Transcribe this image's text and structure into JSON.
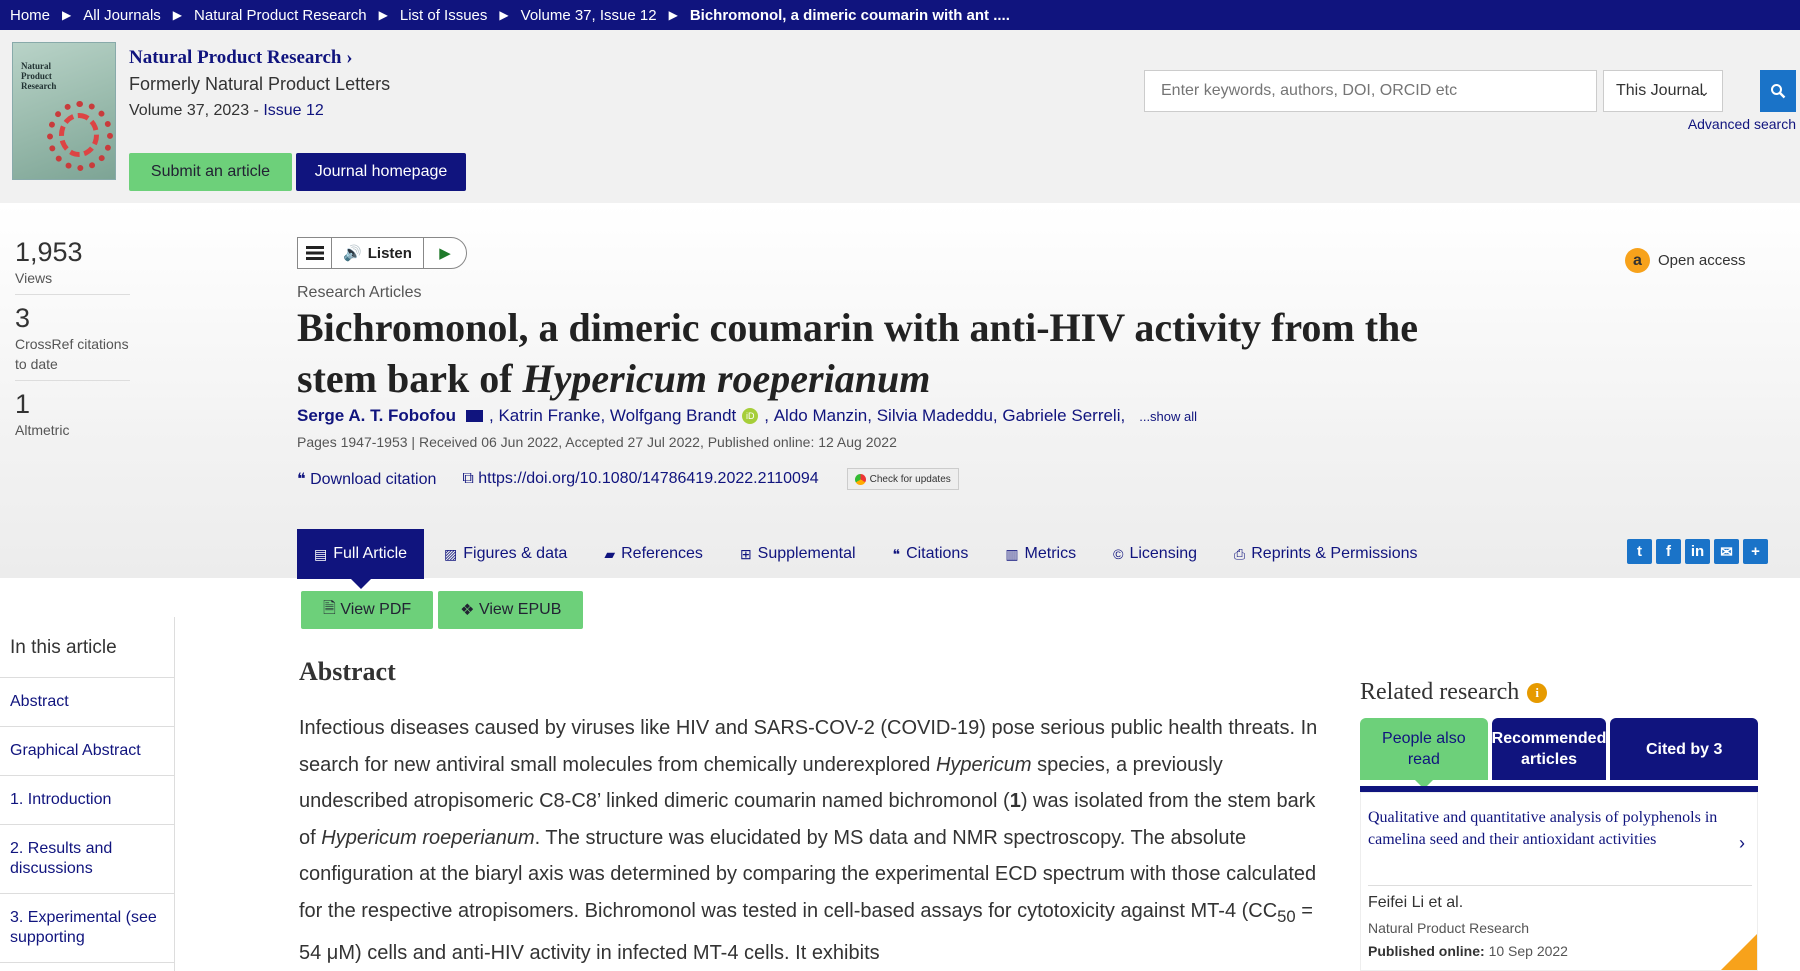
{
  "breadcrumb": {
    "items": [
      "Home",
      "All Journals",
      "Natural Product Research",
      "List of Issues",
      "Volume 37, Issue 12",
      "Bichromonol, a dimeric coumarin with ant ...."
    ]
  },
  "journal": {
    "title": "Natural Product Research",
    "former": "Formerly Natural Product Letters",
    "volume_prefix": "Volume 37, 2023 - ",
    "issue_link": "Issue 12",
    "submit_label": "Submit an article",
    "homepage_label": "Journal homepage",
    "cover_text": "Natural Product Research"
  },
  "search": {
    "placeholder": "Enter keywords, authors, DOI, ORCID etc",
    "scope_value": "This Journal",
    "advanced_label": "Advanced search"
  },
  "metrics": [
    {
      "value": "1,953",
      "label": "Views"
    },
    {
      "value": "3",
      "label": "CrossRef citations to date"
    },
    {
      "value": "1",
      "label": "Altmetric"
    }
  ],
  "toolbar": {
    "listen_label": "Listen"
  },
  "open_access_label": "Open access",
  "article": {
    "type": "Research Articles",
    "title_plain": "Bichromonol, a dimeric coumarin with anti-HIV activity from the stem bark of ",
    "title_italic": "Hypericum roeperianum",
    "first_author": "Serge A. T. Fobofou",
    "authors_a": "Katrin Franke, Wolfgang Brandt",
    "authors_b": "Aldo Manzin, Silvia Madeddu, Gabriele Serreli,",
    "show_all": "...show all",
    "pages_line": "Pages 1947-1953 | Received 06 Jun 2022, Accepted 27 Jul 2022, Published online: 12 Aug 2022",
    "download_citation": "Download citation",
    "doi": "https://doi.org/10.1080/14786419.2022.2110094",
    "check_updates": "Check for updates"
  },
  "tabs": [
    "Full Article",
    "Figures & data",
    "References",
    "Supplemental",
    "Citations",
    "Metrics",
    "Licensing",
    "Reprints & Permissions"
  ],
  "share_icons": [
    "twitter-icon",
    "facebook-icon",
    "linkedin-icon",
    "email-icon",
    "plus-icon"
  ],
  "buttons": {
    "view_pdf": "View PDF",
    "view_epub": "View EPUB"
  },
  "sidebar": {
    "heading": "In this article",
    "items": [
      "Abstract",
      "Graphical Abstract",
      "1. Introduction",
      "2. Results and discussions",
      "3. Experimental (see supporting"
    ]
  },
  "abstract": {
    "heading": "Abstract",
    "p1": "Infectious diseases caused by viruses like HIV and SARS-COV-2 (COVID-19) pose serious public health threats. In search for new antiviral small molecules from chemically underexplored ",
    "i1": "Hypericum",
    "p2": " species, a previously undescribed atropisomeric C8-C8’ linked dimeric coumarin named bichromonol (",
    "b1": "1",
    "p3": ") was isolated from the stem bark of ",
    "i2": "Hypericum roeperianum",
    "p4": ". The structure was elucidated by MS data and NMR spectroscopy. The absolute configuration at the biaryl axis was determined by comparing the experimental ECD spectrum with those calculated for the respective atropisomers. Bichromonol was tested in cell-based assays for cytotoxicity against MT-4 (CC",
    "sub1": "50",
    "p5": " = 54 μM) cells and anti-HIV activity in infected MT-4 cells. It exhibits"
  },
  "related": {
    "heading": "Related research",
    "tabs": [
      "People also read",
      "Recommended articles",
      "Cited by 3"
    ],
    "card": {
      "title": "Qualitative and quantitative analysis of polyphenols in camelina seed and their antioxidant activities",
      "authors": "Feifei Li et al.",
      "journal": "Natural Product Research",
      "published_label": "Published online:",
      "published_date": "10 Sep 2022"
    }
  },
  "colors": {
    "brand_navy": "#10147e",
    "accent_green": "#6dd07a",
    "oa_orange": "#f7a21b",
    "link_blue": "#1a73c8"
  }
}
